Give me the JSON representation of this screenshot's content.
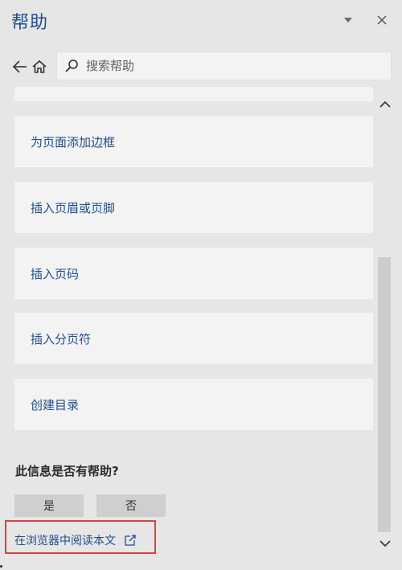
{
  "window": {
    "title": "帮助"
  },
  "nav": {
    "back_icon": "back-arrow-icon",
    "home_icon": "home-icon"
  },
  "search": {
    "placeholder": "搜索帮助",
    "value": ""
  },
  "results": [
    {
      "label": ""
    },
    {
      "label": "为页面添加边框"
    },
    {
      "label": "插入页眉或页脚"
    },
    {
      "label": "插入页码"
    },
    {
      "label": "插入分页符"
    },
    {
      "label": "创建目录"
    }
  ],
  "feedback": {
    "question": "此信息是否有帮助?",
    "yes_label": "是",
    "no_label": "否"
  },
  "browser_link": {
    "label": "在浏览器中阅读本文"
  },
  "colors": {
    "accent": "#1f4e8c",
    "highlight_border": "#e0403a",
    "panel_bg": "#e6e6e6",
    "card_bg": "#f3f3f3"
  }
}
